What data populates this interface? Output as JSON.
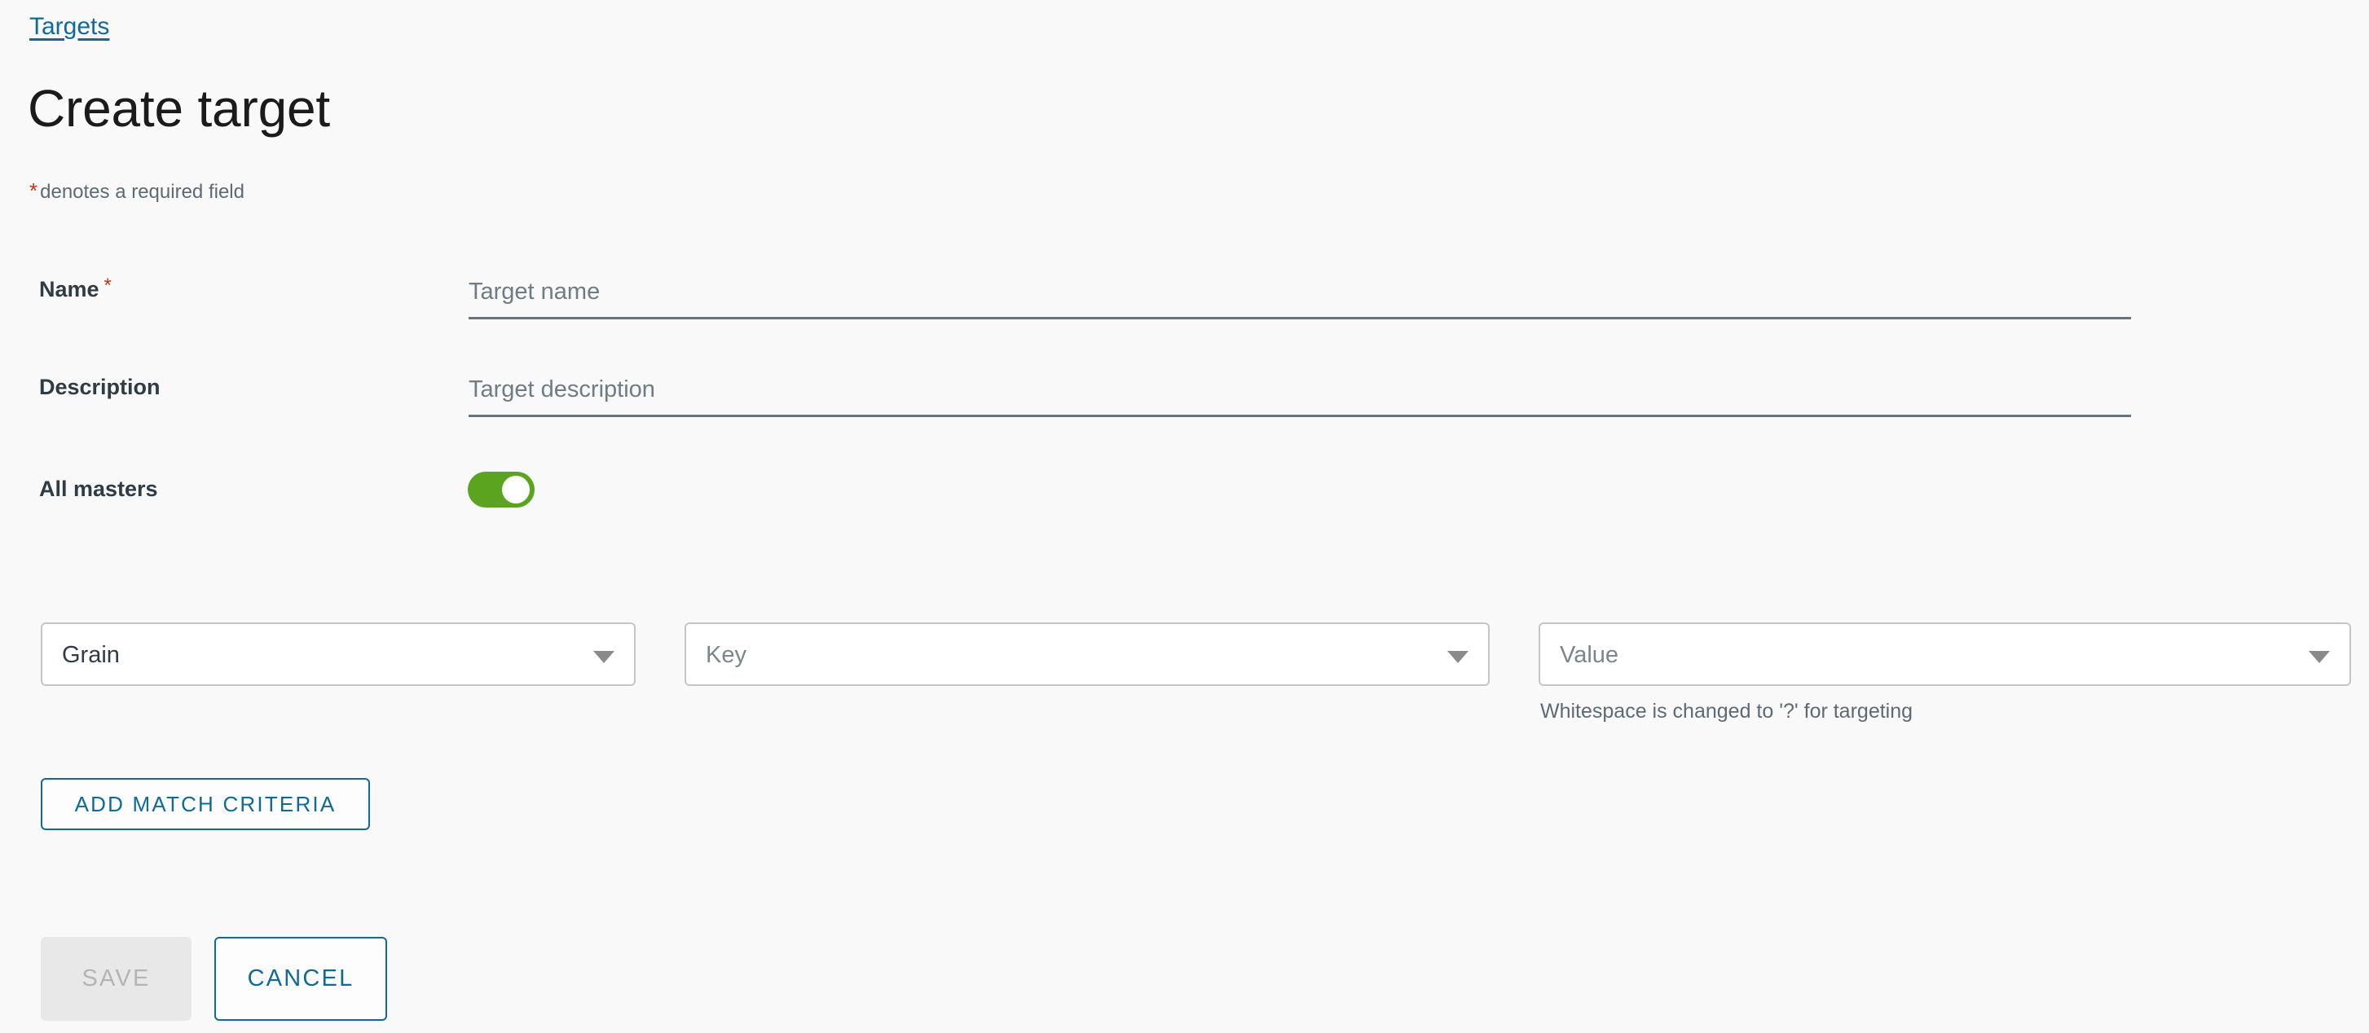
{
  "breadcrumb": {
    "label": "Targets"
  },
  "header": {
    "title": "Create target",
    "required_note": "denotes a required field",
    "required_marker": "*"
  },
  "form": {
    "name": {
      "label": "Name",
      "required_marker": "*",
      "value": "",
      "placeholder": "Target name"
    },
    "description": {
      "label": "Description",
      "value": "",
      "placeholder": "Target description"
    },
    "all_masters": {
      "label": "All masters",
      "state": "on"
    }
  },
  "match_criteria": {
    "grain": {
      "value": "Grain",
      "is_placeholder": false
    },
    "key": {
      "value": "Key",
      "is_placeholder": true
    },
    "value": {
      "value": "Value",
      "is_placeholder": true
    },
    "hint": "Whitespace is changed to '?' for targeting",
    "add_button_label": "ADD MATCH CRITERIA"
  },
  "actions": {
    "save_label": "SAVE",
    "save_enabled": false,
    "cancel_label": "CANCEL"
  },
  "colors": {
    "background": "#f9f9f9",
    "link": "#0d6a9b",
    "accent_blue": "#0d6a9b",
    "toggle_on": "#5aa420",
    "required_red": "#c0341d",
    "underline": "#64757d",
    "disabled_bg": "#e8e8e8",
    "disabled_text": "#b4b4b4"
  }
}
